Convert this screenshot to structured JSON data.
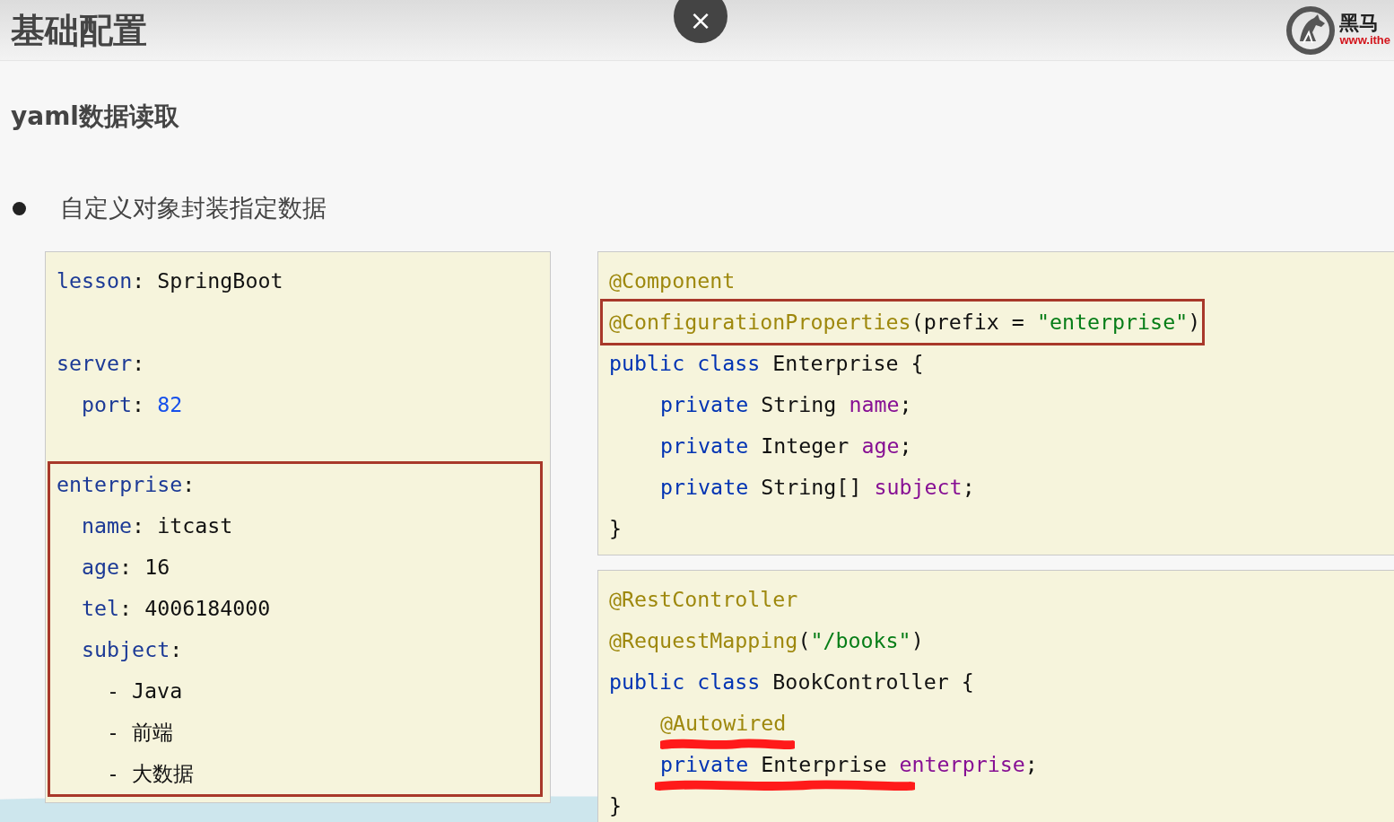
{
  "header": {
    "title": "基础配置",
    "logo": {
      "name": "黑马",
      "url": "www.ithe"
    }
  },
  "close_button": {
    "label": "×"
  },
  "subtitle": "yaml数据读取",
  "bullets": [
    "自定义对象封装指定数据"
  ],
  "code_blocks": [
    {
      "lines": [
        {
          "kind": "code",
          "highlighted": false,
          "underlined": false,
          "tokens": [
            {
              "kind": "key",
              "text": "lesson"
            },
            {
              "kind": "plain",
              "text": ": SpringBoot"
            }
          ]
        },
        {
          "kind": "blank"
        },
        {
          "kind": "code",
          "highlighted": false,
          "underlined": false,
          "tokens": [
            {
              "kind": "key",
              "text": "server"
            },
            {
              "kind": "plain",
              "text": ":"
            }
          ],
          "children": [
            {
              "kind": "code",
              "highlighted": false,
              "underlined": false,
              "tokens": [
                {
                  "kind": "key",
                  "text": "port"
                },
                {
                  "kind": "plain",
                  "text": ": "
                },
                {
                  "kind": "number",
                  "text": "82"
                }
              ]
            }
          ]
        },
        {
          "kind": "blank"
        },
        {
          "kind": "code",
          "highlighted": true,
          "underlined": false,
          "tokens": [
            {
              "kind": "key",
              "text": "enterprise"
            },
            {
              "kind": "plain",
              "text": ":"
            }
          ],
          "children": [
            {
              "kind": "code",
              "highlighted": false,
              "underlined": false,
              "tokens": [
                {
                  "kind": "key",
                  "text": "name"
                },
                {
                  "kind": "plain",
                  "text": ": itcast"
                }
              ]
            },
            {
              "kind": "code",
              "highlighted": false,
              "underlined": false,
              "tokens": [
                {
                  "kind": "key",
                  "text": "age"
                },
                {
                  "kind": "plain",
                  "text": ": 16"
                }
              ]
            },
            {
              "kind": "code",
              "highlighted": false,
              "underlined": false,
              "tokens": [
                {
                  "kind": "key",
                  "text": "tel"
                },
                {
                  "kind": "plain",
                  "text": ": 4006184000"
                }
              ]
            },
            {
              "kind": "code",
              "highlighted": false,
              "underlined": false,
              "tokens": [
                {
                  "kind": "key",
                  "text": "subject"
                },
                {
                  "kind": "plain",
                  "text": ":"
                }
              ],
              "children": [
                {
                  "kind": "code",
                  "highlighted": false,
                  "underlined": false,
                  "tokens": [
                    {
                      "kind": "plain",
                      "text": "- Java"
                    }
                  ]
                },
                {
                  "kind": "code",
                  "highlighted": false,
                  "underlined": false,
                  "tokens": [
                    {
                      "kind": "plain",
                      "text": "- 前端"
                    }
                  ]
                },
                {
                  "kind": "code",
                  "highlighted": false,
                  "underlined": false,
                  "tokens": [
                    {
                      "kind": "plain",
                      "text": "- 大数据"
                    }
                  ]
                }
              ]
            }
          ]
        }
      ]
    },
    {
      "lines": [
        {
          "kind": "code",
          "highlighted": false,
          "underlined": false,
          "tokens": [
            {
              "kind": "annotation",
              "text": "@Component"
            }
          ]
        },
        {
          "kind": "code",
          "highlighted": true,
          "underlined": false,
          "tokens": [
            {
              "kind": "annotation",
              "text": "@ConfigurationProperties"
            },
            {
              "kind": "plain",
              "text": "(prefix = "
            },
            {
              "kind": "string",
              "text": "\"enterprise\""
            },
            {
              "kind": "plain",
              "text": ")"
            }
          ]
        },
        {
          "kind": "code",
          "highlighted": false,
          "underlined": false,
          "tokens": [
            {
              "kind": "keyword",
              "text": "public class"
            },
            {
              "kind": "plain",
              "text": " Enterprise {"
            }
          ],
          "children": [
            {
              "kind": "code",
              "highlighted": false,
              "underlined": false,
              "tokens": [
                {
                  "kind": "keyword",
                  "text": "private"
                },
                {
                  "kind": "plain",
                  "text": " String "
                },
                {
                  "kind": "field",
                  "text": "name"
                },
                {
                  "kind": "plain",
                  "text": ";"
                }
              ]
            },
            {
              "kind": "code",
              "highlighted": false,
              "underlined": false,
              "tokens": [
                {
                  "kind": "keyword",
                  "text": "private"
                },
                {
                  "kind": "plain",
                  "text": " Integer "
                },
                {
                  "kind": "field",
                  "text": "age"
                },
                {
                  "kind": "plain",
                  "text": ";"
                }
              ]
            },
            {
              "kind": "code",
              "highlighted": false,
              "underlined": false,
              "tokens": [
                {
                  "kind": "keyword",
                  "text": "private"
                },
                {
                  "kind": "plain",
                  "text": " String[] "
                },
                {
                  "kind": "field",
                  "text": "subject"
                },
                {
                  "kind": "plain",
                  "text": ";"
                }
              ]
            }
          ]
        },
        {
          "kind": "code",
          "highlighted": false,
          "underlined": false,
          "tokens": [
            {
              "kind": "plain",
              "text": "}"
            }
          ]
        }
      ]
    },
    {
      "lines": [
        {
          "kind": "code",
          "highlighted": false,
          "underlined": false,
          "tokens": [
            {
              "kind": "annotation",
              "text": "@RestController"
            }
          ]
        },
        {
          "kind": "code",
          "highlighted": false,
          "underlined": false,
          "tokens": [
            {
              "kind": "annotation",
              "text": "@RequestMapping"
            },
            {
              "kind": "plain",
              "text": "("
            },
            {
              "kind": "string",
              "text": "\"/books\""
            },
            {
              "kind": "plain",
              "text": ")"
            }
          ]
        },
        {
          "kind": "code",
          "highlighted": false,
          "underlined": false,
          "tokens": [
            {
              "kind": "keyword",
              "text": "public class"
            },
            {
              "kind": "plain",
              "text": " BookController {"
            }
          ],
          "children": [
            {
              "kind": "code",
              "highlighted": false,
              "underlined": true,
              "tokens": [
                {
                  "kind": "annotation",
                  "text": "@Autowired"
                }
              ]
            },
            {
              "kind": "code",
              "highlighted": false,
              "underlined": true,
              "tokens": [
                {
                  "kind": "keyword",
                  "text": "private"
                },
                {
                  "kind": "plain",
                  "text": " Enterprise "
                },
                {
                  "kind": "field",
                  "text": "enterprise"
                },
                {
                  "kind": "plain",
                  "text": ";"
                }
              ]
            }
          ]
        },
        {
          "kind": "code",
          "highlighted": false,
          "underlined": false,
          "tokens": [
            {
              "kind": "plain",
              "text": "}"
            }
          ]
        }
      ]
    }
  ]
}
